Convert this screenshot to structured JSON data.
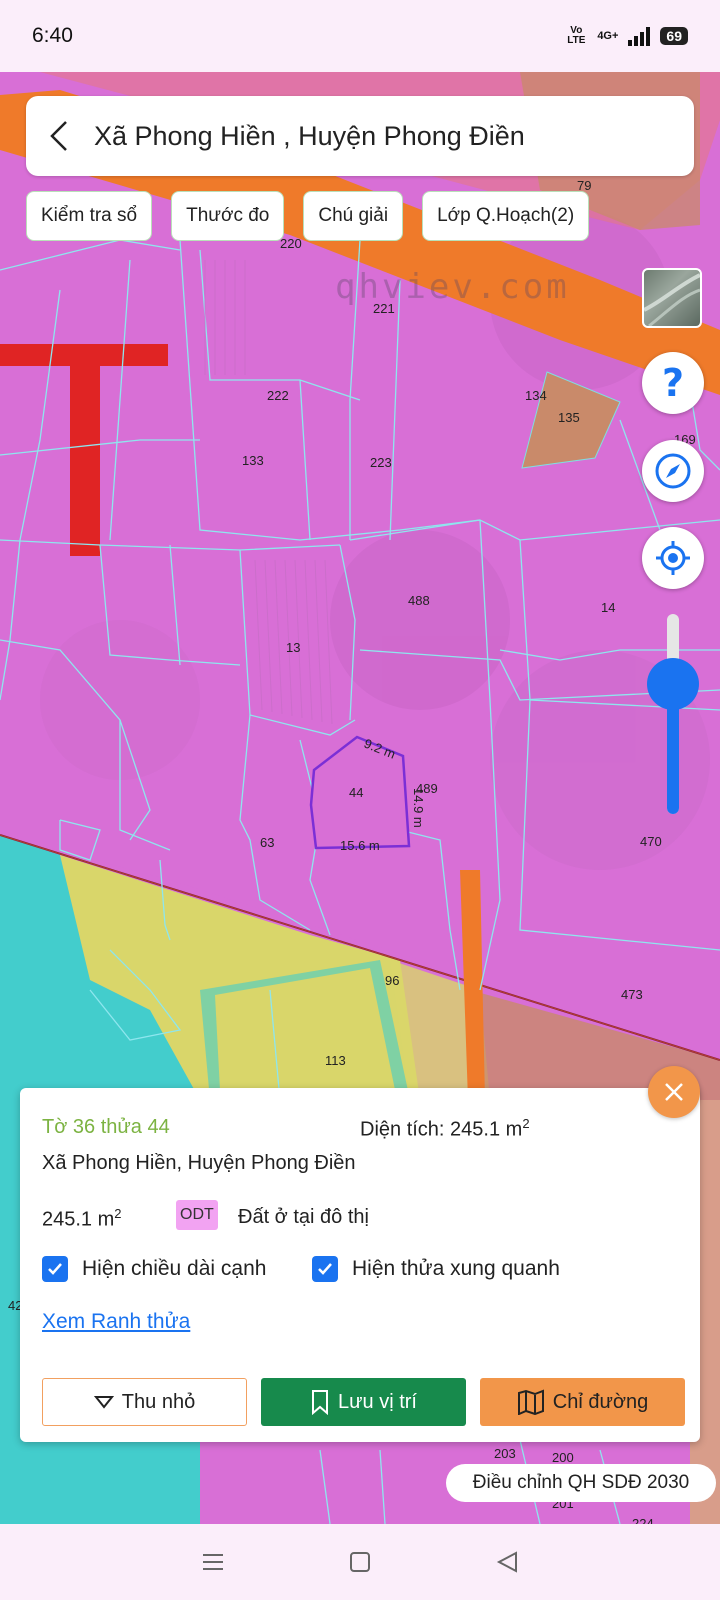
{
  "status_bar": {
    "time": "6:40",
    "network": "4G+",
    "volte": "Vo LTE",
    "battery": "69"
  },
  "header": {
    "title": "Xã Phong Hiền , Huyện Phong Điền"
  },
  "toolbar": {
    "chips": [
      "Kiểm tra sổ",
      "Thước đo",
      "Chú giải",
      "Lớp Q.Hoạch(2)"
    ]
  },
  "map": {
    "watermark": "qhviev.com",
    "parcel_labels": [
      "79",
      "220",
      "221",
      "222",
      "133",
      "223",
      "134",
      "135",
      "169",
      "488",
      "14",
      "13",
      "44",
      "489",
      "63",
      "470",
      "96",
      "473",
      "113",
      "42",
      "203",
      "200",
      "201",
      "224"
    ],
    "edge_labels": [
      "9.2 m",
      "14.9 m",
      "15.6 m"
    ],
    "colors": {
      "residential": "#d86fd6",
      "water": "#43cdcc",
      "agriculture": "#d9d66a",
      "road": "#ef7a2a",
      "highlight": "#7b2fd6",
      "brown": "#c98a6a"
    }
  },
  "controls": {
    "help_icon": "question-icon",
    "compass_icon": "compass-icon",
    "locate_icon": "locate-icon",
    "zoom_level": 0.64
  },
  "info": {
    "parcel_id": "Tờ 36 thửa 44",
    "area_label": "Diện tích: 245.1 m",
    "area_sup": "2",
    "address": "Xã Phong Hiền, Huyện Phong Điền",
    "area_value": "245.1 m",
    "area_value_sup": "2",
    "land_code": "ODT",
    "land_name": "Đất ở tại đô thị",
    "show_edges_label": "Hiện chiều dài cạnh",
    "show_edges_checked": true,
    "show_neighbors_label": "Hiện thửa xung quanh",
    "show_neighbors_checked": true,
    "boundary_link": "Xem Ranh thửa",
    "collapse_button": "Thu nhỏ",
    "save_button": "Lưu vị trí",
    "directions_button": "Chỉ đường"
  },
  "plan_badge": "Điều chỉnh QH SDĐ 2030"
}
